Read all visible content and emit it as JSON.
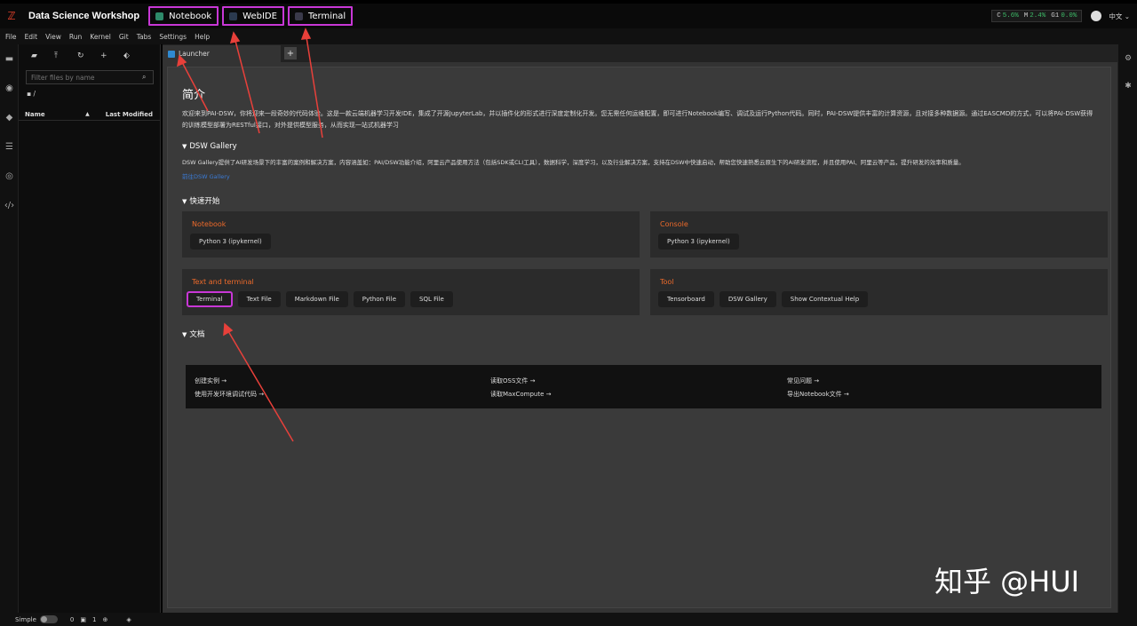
{
  "topbar": {
    "title": "Data Science Workshop",
    "tabs": [
      {
        "label": "Notebook",
        "icon": "notebook-icon",
        "color": "#2e8b6a"
      },
      {
        "label": "WebIDE",
        "icon": "code-icon",
        "color": "#2b3a4f"
      },
      {
        "label": "Terminal",
        "icon": "terminal-icon",
        "color": "#3a3a4a"
      }
    ],
    "resources": {
      "c_label": "C",
      "c_value": "5.6%",
      "m_label": "M",
      "m_value": "2.4%",
      "g_label": "G1",
      "g_value": "0.0%"
    },
    "language": "中文 ⌄"
  },
  "menu": [
    "File",
    "Edit",
    "View",
    "Run",
    "Kernel",
    "Git",
    "Tabs",
    "Settings",
    "Help"
  ],
  "filebrowser": {
    "search_placeholder": "Filter files by name",
    "path": "/",
    "col_name": "Name",
    "col_modified": "Last Modified"
  },
  "launcher": {
    "tab_label": "Launcher",
    "intro_title": "简介",
    "intro_text": "欢迎来到PAI-DSW，你将迎来一段奇妙的代码体验。这是一款云端机器学习开发IDE，集成了开源JupyterLab，并以插件化的形式进行深度定制化开发。您无需任何运维配置，即可进行Notebook编写、调试及运行Python代码。同时，PAI-DSW提供丰富的计算资源，且对接多种数据源。通过EASCMD的方式，可以将PAI-DSW获得的训练模型部署为RESTful接口，对外提供模型服务，从而实现一站式机器学习",
    "gallery_title": "DSW Gallery",
    "gallery_text": "DSW Gallery提供了AI研发场景下的丰富的案例和解决方案，内容涵盖如：PAI/DSW功能介绍，阿里云产品使用方法（包括SDK或CLI工具），数据科学，深度学习，以及行业解决方案，支持在DSW中快速启动，帮助您快速熟悉云原生下的AI研发流程，并且使用PAI、阿里云等产品，提升研发的效率和质量。",
    "gallery_link": "前往DSW Gallery",
    "quickstart_title": "快速开始",
    "cards": {
      "notebook": {
        "title": "Notebook",
        "buttons": [
          "Python 3 (ipykernel)"
        ]
      },
      "console": {
        "title": "Console",
        "buttons": [
          "Python 3 (ipykernel)"
        ]
      },
      "text_terminal": {
        "title": "Text and terminal",
        "buttons": [
          "Terminal",
          "Text File",
          "Markdown File",
          "Python File",
          "SQL File"
        ]
      },
      "tool": {
        "title": "Tool",
        "buttons": [
          "Tensorboard",
          "DSW Gallery",
          "Show Contextual Help"
        ]
      }
    },
    "docs_title": "文档",
    "docs": [
      "创建实例 →",
      "使用开发环境调试代码 →",
      "读取OSS文件 →",
      "读取MaxCompute →",
      "常见问题 →",
      "导出Notebook文件 →"
    ]
  },
  "status": {
    "mode": "Simple",
    "count_a": "0",
    "count_b": "1"
  },
  "watermark": "知乎 @HUI",
  "colors": {
    "highlight": "#c837d6",
    "arrow": "#e8403a",
    "accent": "#ec6a2b"
  }
}
